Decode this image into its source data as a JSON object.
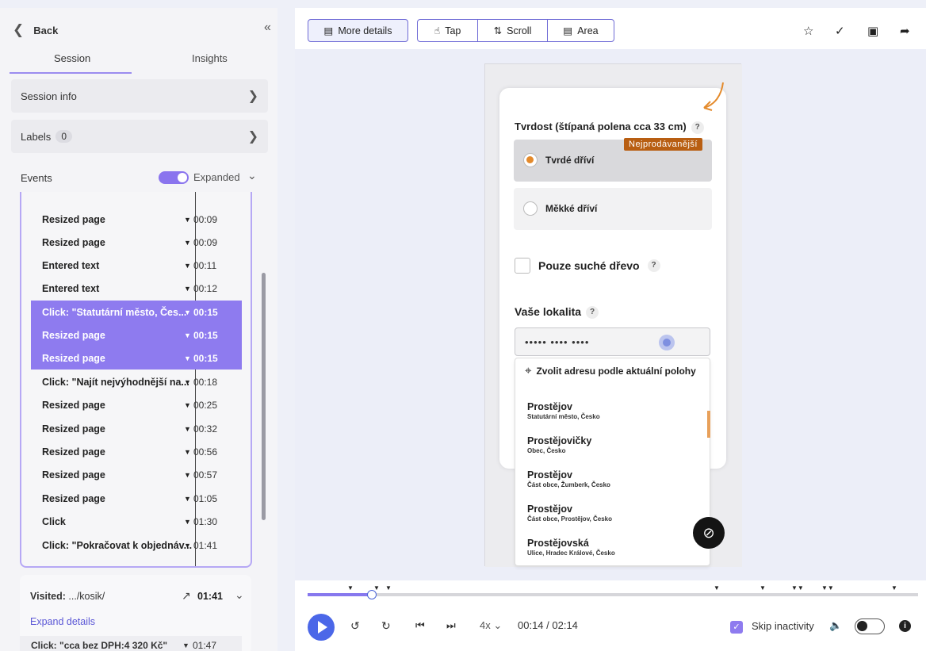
{
  "sidebar": {
    "back_label": "Back",
    "tabs": [
      {
        "label": "Session"
      },
      {
        "label": "Insights"
      }
    ],
    "session_info": "Session info",
    "labels": {
      "label": "Labels",
      "count": "0"
    },
    "events": {
      "label": "Events",
      "toggle_label": "Expanded"
    },
    "event_rows": [
      {
        "label": "Resized page",
        "time": "00:09",
        "selected": false
      },
      {
        "label": "Resized page",
        "time": "00:09",
        "selected": false
      },
      {
        "label": "Entered text",
        "time": "00:11",
        "selected": false
      },
      {
        "label": "Entered text",
        "time": "00:12",
        "selected": false
      },
      {
        "label": "Click: \"Statutární město, Čes...",
        "time": "00:15",
        "selected": true
      },
      {
        "label": "Resized page",
        "time": "00:15",
        "selected": true
      },
      {
        "label": "Resized page",
        "time": "00:15",
        "selected": true
      },
      {
        "label": "Click: \"Najít nejvýhodnější na...",
        "time": "00:18",
        "selected": false
      },
      {
        "label": "Resized page",
        "time": "00:25",
        "selected": false
      },
      {
        "label": "Resized page",
        "time": "00:32",
        "selected": false
      },
      {
        "label": "Resized page",
        "time": "00:56",
        "selected": false
      },
      {
        "label": "Resized page",
        "time": "00:57",
        "selected": false
      },
      {
        "label": "Resized page",
        "time": "01:05",
        "selected": false
      },
      {
        "label": "Click",
        "time": "01:30",
        "selected": false
      },
      {
        "label": "Click: \"Pokračovat k objednáv...",
        "time": "01:41",
        "selected": false
      }
    ],
    "visited": {
      "prefix": "Visited:",
      "path": ".../kosik/",
      "time": "01:41",
      "expand_label": "Expand details",
      "row": {
        "label": "Click: \"cca bez DPH:4 320 Kč\"",
        "time": "01:47"
      }
    }
  },
  "toolbar": {
    "more_details": "More details",
    "tap": "Tap",
    "scroll": "Scroll",
    "area": "Area"
  },
  "recording": {
    "section_title": "Tvrdost (štípaná polena cca 33 cm)",
    "tag": "Nejprodávanější",
    "options": [
      {
        "label": "Tvrdé dříví",
        "selected": true
      },
      {
        "label": "Měkké dříví",
        "selected": false
      }
    ],
    "checkbox_label": "Pouze suché dřevo",
    "location_title": "Vaše lokalita",
    "location_value": "••••• •••• ••••",
    "use_location": "Zvolit adresu podle aktuální polohy",
    "suggestions": [
      {
        "name": "Prostějov",
        "sub": "Statutární město, Česko"
      },
      {
        "name": "Prostějovičky",
        "sub": "Obec, Česko"
      },
      {
        "name": "Prostějov",
        "sub": "Část obce, Žumberk, Česko"
      },
      {
        "name": "Prostějov",
        "sub": "Část obce, Prostějov, Česko"
      },
      {
        "name": "Prostějovská",
        "sub": "Ulice, Hradec Králové, Česko"
      }
    ],
    "accent_color": "#e48a2b",
    "tag_color": "#b85e12"
  },
  "player": {
    "speed": "4x",
    "time": "00:14 / 02:14",
    "skip_inactivity": "Skip inactivity",
    "progress": 0.105,
    "accent_color": "#8778ee"
  }
}
